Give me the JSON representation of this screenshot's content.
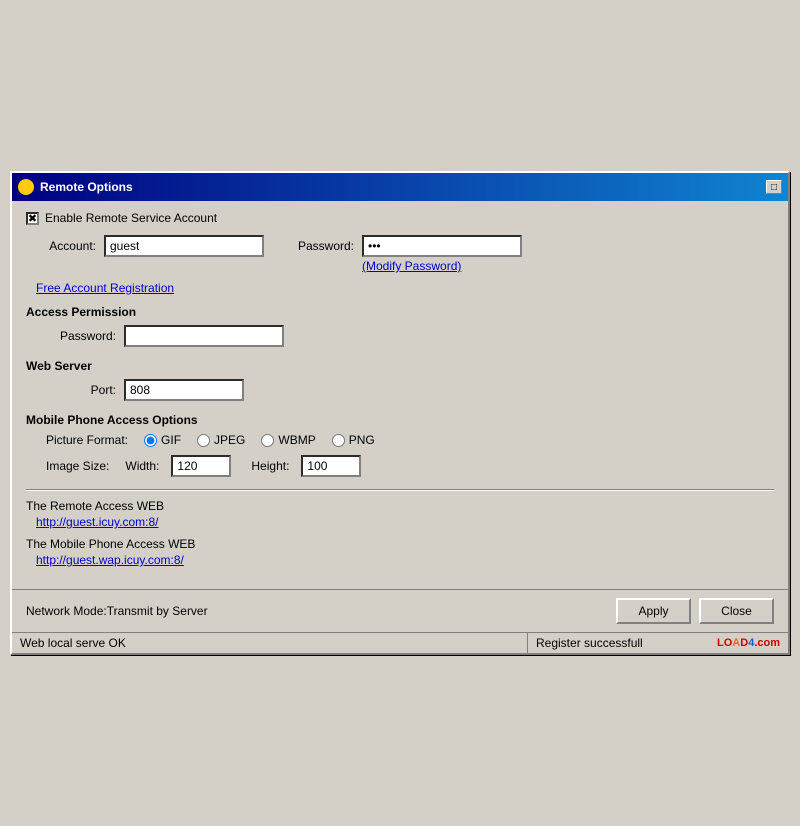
{
  "window": {
    "title": "Remote Options",
    "icon": "⚡"
  },
  "titlebar": {
    "maximize_label": "□"
  },
  "enable_remote": {
    "checkbox_checked": "✖",
    "label": "Enable Remote Service Account"
  },
  "account_section": {
    "account_label": "Account:",
    "account_value": "guest",
    "password_label": "Password:",
    "password_value": "***",
    "modify_password_link": "(Modify Password)"
  },
  "free_registration": {
    "link_text": "Free Account Registration"
  },
  "access_permission": {
    "section_label": "Access Permission",
    "password_label": "Password:",
    "password_value": ""
  },
  "web_server": {
    "section_label": "Web Server",
    "port_label": "Port:",
    "port_value": "808"
  },
  "mobile_options": {
    "section_label": "Mobile Phone Access Options",
    "picture_format_label": "Picture Format:",
    "formats": [
      "GIF",
      "JPEG",
      "WBMP",
      "PNG"
    ],
    "selected_format": "GIF",
    "image_size_label": "Image Size:",
    "width_label": "Width:",
    "width_value": "120",
    "height_label": "Height:",
    "height_value": "100"
  },
  "remote_access": {
    "label": "The Remote Access WEB",
    "url": "http://guest.icuy.com:8/"
  },
  "mobile_access": {
    "label": "The Mobile Phone Access WEB",
    "url": "http://guest.wap.icuy.com:8/"
  },
  "bottom": {
    "network_mode": "Network Mode:Transmit by Server",
    "apply_label": "Apply",
    "close_label": "Close"
  },
  "statusbar": {
    "left_text": "Web local  serve OK",
    "right_text": "Register successfull"
  }
}
